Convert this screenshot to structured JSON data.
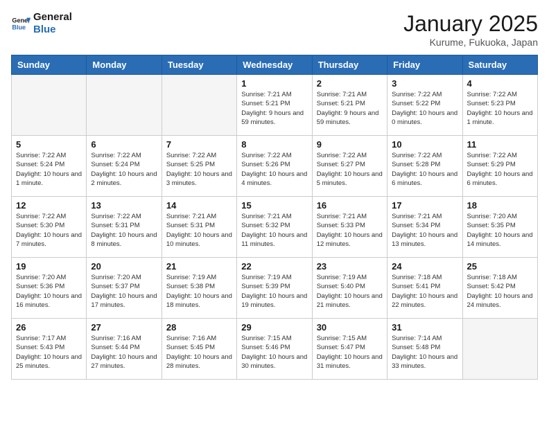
{
  "logo": {
    "line1": "General",
    "line2": "Blue"
  },
  "title": "January 2025",
  "subtitle": "Kurume, Fukuoka, Japan",
  "weekdays": [
    "Sunday",
    "Monday",
    "Tuesday",
    "Wednesday",
    "Thursday",
    "Friday",
    "Saturday"
  ],
  "weeks": [
    [
      {
        "day": "",
        "info": ""
      },
      {
        "day": "",
        "info": ""
      },
      {
        "day": "",
        "info": ""
      },
      {
        "day": "1",
        "info": "Sunrise: 7:21 AM\nSunset: 5:21 PM\nDaylight: 9 hours and 59 minutes."
      },
      {
        "day": "2",
        "info": "Sunrise: 7:21 AM\nSunset: 5:21 PM\nDaylight: 9 hours and 59 minutes."
      },
      {
        "day": "3",
        "info": "Sunrise: 7:22 AM\nSunset: 5:22 PM\nDaylight: 10 hours and 0 minutes."
      },
      {
        "day": "4",
        "info": "Sunrise: 7:22 AM\nSunset: 5:23 PM\nDaylight: 10 hours and 1 minute."
      }
    ],
    [
      {
        "day": "5",
        "info": "Sunrise: 7:22 AM\nSunset: 5:24 PM\nDaylight: 10 hours and 1 minute."
      },
      {
        "day": "6",
        "info": "Sunrise: 7:22 AM\nSunset: 5:24 PM\nDaylight: 10 hours and 2 minutes."
      },
      {
        "day": "7",
        "info": "Sunrise: 7:22 AM\nSunset: 5:25 PM\nDaylight: 10 hours and 3 minutes."
      },
      {
        "day": "8",
        "info": "Sunrise: 7:22 AM\nSunset: 5:26 PM\nDaylight: 10 hours and 4 minutes."
      },
      {
        "day": "9",
        "info": "Sunrise: 7:22 AM\nSunset: 5:27 PM\nDaylight: 10 hours and 5 minutes."
      },
      {
        "day": "10",
        "info": "Sunrise: 7:22 AM\nSunset: 5:28 PM\nDaylight: 10 hours and 6 minutes."
      },
      {
        "day": "11",
        "info": "Sunrise: 7:22 AM\nSunset: 5:29 PM\nDaylight: 10 hours and 6 minutes."
      }
    ],
    [
      {
        "day": "12",
        "info": "Sunrise: 7:22 AM\nSunset: 5:30 PM\nDaylight: 10 hours and 7 minutes."
      },
      {
        "day": "13",
        "info": "Sunrise: 7:22 AM\nSunset: 5:31 PM\nDaylight: 10 hours and 8 minutes."
      },
      {
        "day": "14",
        "info": "Sunrise: 7:21 AM\nSunset: 5:31 PM\nDaylight: 10 hours and 10 minutes."
      },
      {
        "day": "15",
        "info": "Sunrise: 7:21 AM\nSunset: 5:32 PM\nDaylight: 10 hours and 11 minutes."
      },
      {
        "day": "16",
        "info": "Sunrise: 7:21 AM\nSunset: 5:33 PM\nDaylight: 10 hours and 12 minutes."
      },
      {
        "day": "17",
        "info": "Sunrise: 7:21 AM\nSunset: 5:34 PM\nDaylight: 10 hours and 13 minutes."
      },
      {
        "day": "18",
        "info": "Sunrise: 7:20 AM\nSunset: 5:35 PM\nDaylight: 10 hours and 14 minutes."
      }
    ],
    [
      {
        "day": "19",
        "info": "Sunrise: 7:20 AM\nSunset: 5:36 PM\nDaylight: 10 hours and 16 minutes."
      },
      {
        "day": "20",
        "info": "Sunrise: 7:20 AM\nSunset: 5:37 PM\nDaylight: 10 hours and 17 minutes."
      },
      {
        "day": "21",
        "info": "Sunrise: 7:19 AM\nSunset: 5:38 PM\nDaylight: 10 hours and 18 minutes."
      },
      {
        "day": "22",
        "info": "Sunrise: 7:19 AM\nSunset: 5:39 PM\nDaylight: 10 hours and 19 minutes."
      },
      {
        "day": "23",
        "info": "Sunrise: 7:19 AM\nSunset: 5:40 PM\nDaylight: 10 hours and 21 minutes."
      },
      {
        "day": "24",
        "info": "Sunrise: 7:18 AM\nSunset: 5:41 PM\nDaylight: 10 hours and 22 minutes."
      },
      {
        "day": "25",
        "info": "Sunrise: 7:18 AM\nSunset: 5:42 PM\nDaylight: 10 hours and 24 minutes."
      }
    ],
    [
      {
        "day": "26",
        "info": "Sunrise: 7:17 AM\nSunset: 5:43 PM\nDaylight: 10 hours and 25 minutes."
      },
      {
        "day": "27",
        "info": "Sunrise: 7:16 AM\nSunset: 5:44 PM\nDaylight: 10 hours and 27 minutes."
      },
      {
        "day": "28",
        "info": "Sunrise: 7:16 AM\nSunset: 5:45 PM\nDaylight: 10 hours and 28 minutes."
      },
      {
        "day": "29",
        "info": "Sunrise: 7:15 AM\nSunset: 5:46 PM\nDaylight: 10 hours and 30 minutes."
      },
      {
        "day": "30",
        "info": "Sunrise: 7:15 AM\nSunset: 5:47 PM\nDaylight: 10 hours and 31 minutes."
      },
      {
        "day": "31",
        "info": "Sunrise: 7:14 AM\nSunset: 5:48 PM\nDaylight: 10 hours and 33 minutes."
      },
      {
        "day": "",
        "info": ""
      }
    ]
  ]
}
